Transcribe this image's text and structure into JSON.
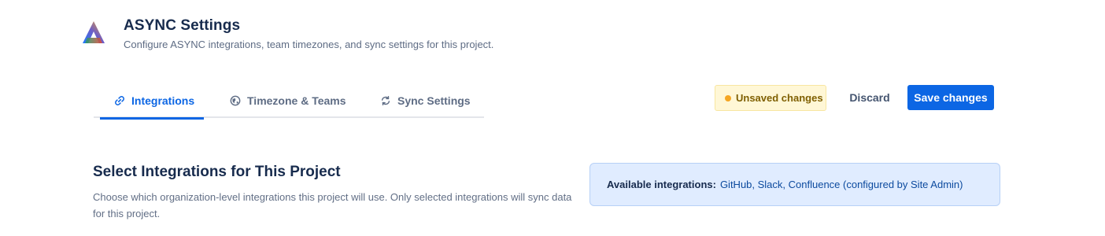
{
  "header": {
    "title": "ASYNC Settings",
    "subtitle": "Configure ASYNC integrations, team timezones, and sync settings for this project."
  },
  "tabs": [
    {
      "label": "Integrations",
      "icon": "link-icon",
      "active": true
    },
    {
      "label": "Timezone & Teams",
      "icon": "globe-icon",
      "active": false
    },
    {
      "label": "Sync Settings",
      "icon": "sync-icon",
      "active": false
    }
  ],
  "toolbar": {
    "unsaved_label": "Unsaved changes",
    "discard_label": "Discard",
    "save_label": "Save changes"
  },
  "section": {
    "title": "Select Integrations for This Project",
    "description": "Choose which organization-level integrations this project will use. Only selected integrations will sync data for this project."
  },
  "info": {
    "label": "Available integrations:",
    "text": "GitHub, Slack, Confluence (configured by Site Admin)"
  },
  "colors": {
    "accent": "#0c66e4",
    "warning_bg": "#fff7d6",
    "info_bg": "#e0ecff"
  }
}
